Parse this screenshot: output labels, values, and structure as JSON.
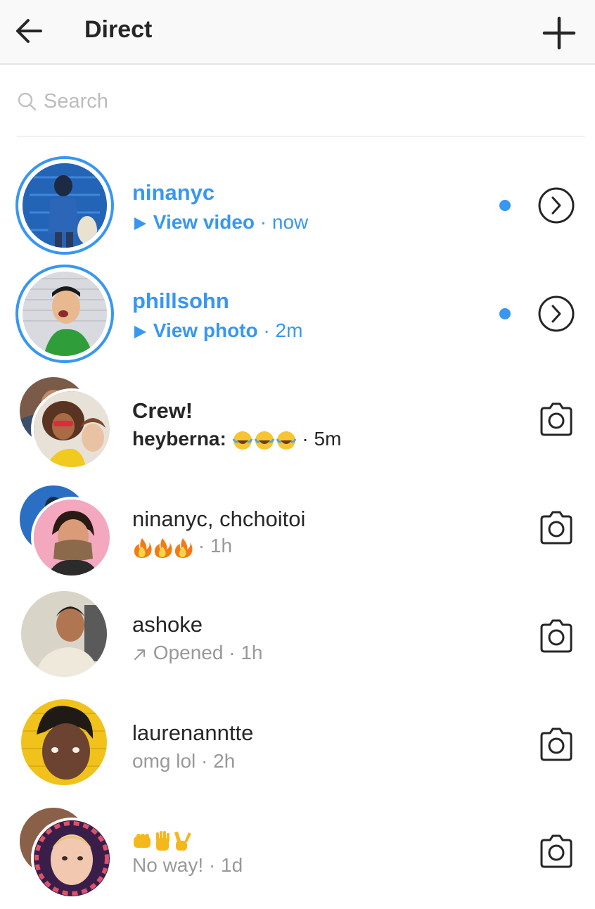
{
  "header": {
    "title": "Direct",
    "back_icon": "arrow-left-icon",
    "compose_icon": "plus-icon"
  },
  "search": {
    "placeholder": "Search",
    "icon": "search-icon"
  },
  "colors": {
    "accent": "#3897f0",
    "text": "#262626",
    "muted": "#999999"
  },
  "threads": [
    {
      "name": "ninanyc",
      "state": "unread",
      "media_label": "View video",
      "time": "now",
      "action_icon": "chevron-right-circle-icon",
      "unread_dot": true
    },
    {
      "name": "phillsohn",
      "state": "unread",
      "media_label": "View photo",
      "time": "2m",
      "action_icon": "chevron-right-circle-icon",
      "unread_dot": true
    },
    {
      "name": "Crew!",
      "state": "bold",
      "sender": "heyberna:",
      "emoji": "laughing-tears-emoji x3",
      "time": "5m",
      "action_icon": "camera-icon"
    },
    {
      "name": "ninanyc, chchoitoi",
      "state": "normal",
      "emoji": "fire-emoji x3",
      "time": "1h",
      "action_icon": "camera-icon"
    },
    {
      "name": "ashoke",
      "state": "normal",
      "status": "Opened",
      "time": "1h",
      "action_icon": "camera-icon"
    },
    {
      "name": "laurenanntte",
      "state": "normal",
      "message": "omg lol",
      "time": "2h",
      "action_icon": "camera-icon"
    },
    {
      "name_emoji": "fist-hand-victory-emoji",
      "state": "normal",
      "message": "No way!",
      "time": "1d",
      "action_icon": "camera-icon"
    }
  ],
  "separator": "·"
}
